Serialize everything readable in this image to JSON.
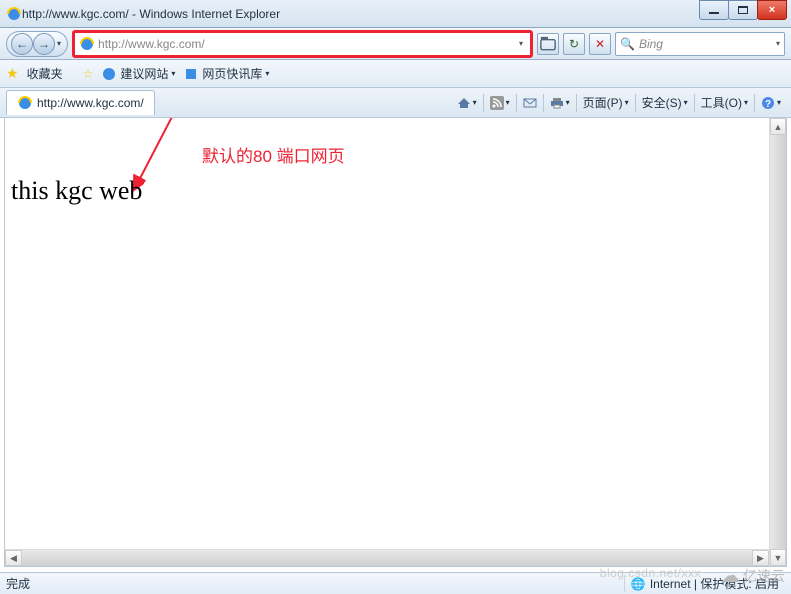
{
  "window": {
    "title": "http://www.kgc.com/ - Windows Internet Explorer",
    "buttons": {
      "minimize": "min",
      "maximize": "max",
      "close": "×"
    }
  },
  "nav": {
    "back": "←",
    "forward": "→",
    "url": "http://www.kgc.com/",
    "refresh": "↻",
    "stop": "✕",
    "compat_icon": "compatibility-icon",
    "search_placeholder": "Bing"
  },
  "favbar": {
    "star_label": "收藏夹",
    "suggested_label": "建议网站",
    "quick_label": "网页快讯库"
  },
  "tab": {
    "label": "http://www.kgc.com/"
  },
  "commandbar": {
    "home": "主页",
    "feeds": "订阅",
    "mail": "邮件",
    "print": "打印",
    "page": "页面(P)",
    "safety": "安全(S)",
    "tools": "工具(O)",
    "help": "?"
  },
  "page": {
    "body_text": "this kgc web",
    "annotation": "默认的80 端口网页"
  },
  "statusbar": {
    "done": "完成",
    "zone": "Internet | 保护模式: 启用"
  },
  "watermark": {
    "text": "blog.csdn.net/xxx",
    "logo": "亿速云"
  }
}
